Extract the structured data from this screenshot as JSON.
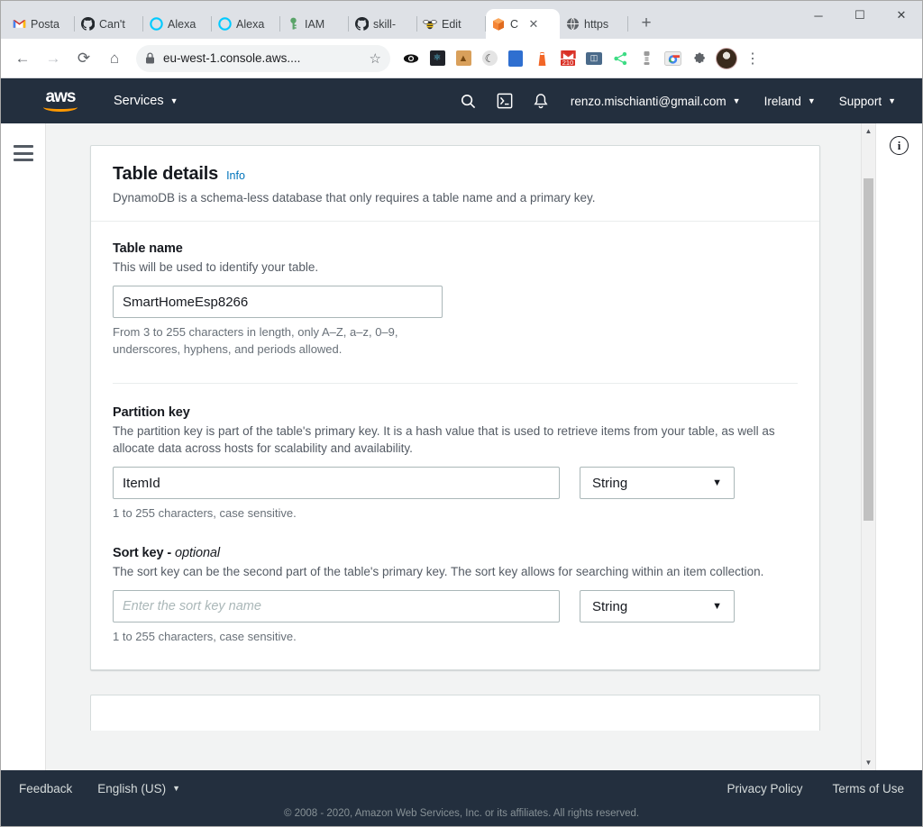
{
  "browser": {
    "tabs": [
      {
        "label": "Posta",
        "icon": "gmail-icon",
        "active": false
      },
      {
        "label": "Can't",
        "icon": "github-icon",
        "active": false
      },
      {
        "label": "Alexa",
        "icon": "alexa-icon",
        "active": false
      },
      {
        "label": "Alexa",
        "icon": "alexa-icon",
        "active": false
      },
      {
        "label": "IAM",
        "icon": "key-icon",
        "active": false
      },
      {
        "label": "skill-",
        "icon": "github-icon",
        "active": false
      },
      {
        "label": "Edit",
        "icon": "bee-icon",
        "active": false
      },
      {
        "label": "C",
        "icon": "aws-cube-icon",
        "active": true
      },
      {
        "label": "https",
        "icon": "globe-icon",
        "active": false
      }
    ],
    "new_tab_label": "+",
    "window_controls": {
      "minimize": "─",
      "maximize": "☐",
      "close": "✕"
    },
    "toolbar": {
      "back": "←",
      "forward": "→",
      "reload": "⟳",
      "home": "⌂",
      "lock_icon": "lock-icon",
      "url": "eu-west-1.console.aws....",
      "bookmark_star": "☆",
      "menu_dots": "⋮"
    },
    "extensions": [
      {
        "name": "eye-icon",
        "glyph": "◉",
        "color": "#1a1a1a",
        "bg": "transparent"
      },
      {
        "name": "react-devtools-icon",
        "glyph": "⚛",
        "color": "#61dafb",
        "bg": "#20232a"
      },
      {
        "name": "camel-notebook-icon",
        "glyph": "🐪",
        "color": "#7a4a12",
        "bg": "#d9a05b"
      },
      {
        "name": "dark-mode-moon-icon",
        "glyph": "☾",
        "color": "#444",
        "bg": "#e8e8e8"
      },
      {
        "name": "blue-square-icon",
        "glyph": "",
        "color": "#fff",
        "bg": "#2f6fd0"
      },
      {
        "name": "lighthouse-icon",
        "glyph": "⛯",
        "color": "#fff",
        "bg": "#f26627"
      },
      {
        "name": "gmail-checker-icon",
        "glyph": "210",
        "color": "#fff",
        "bg": "#d93025"
      },
      {
        "name": "window-icon",
        "glyph": "▣",
        "color": "#fff",
        "bg": "#4a6a8a"
      },
      {
        "name": "share-icon",
        "glyph": "∴",
        "color": "#3ddc84",
        "bg": "transparent"
      },
      {
        "name": "robot-icon",
        "glyph": "♟",
        "color": "#8a8a8a",
        "bg": "transparent"
      },
      {
        "name": "chrome-window-icon",
        "glyph": "◑",
        "color": "#888",
        "bg": "#e9e9e9"
      },
      {
        "name": "puzzle-extension-icon",
        "glyph": "✦",
        "color": "#5f6368",
        "bg": "transparent"
      }
    ]
  },
  "aws": {
    "navbar": {
      "logo_word": "aws",
      "services_label": "Services",
      "search_icon": "search-icon",
      "cloudshell_icon": "cloudshell-icon",
      "bell_icon": "notifications-bell-icon",
      "account": "renzo.mischianti@gmail.com",
      "region": "Ireland",
      "support": "Support",
      "caret": "▼"
    },
    "card": {
      "title": "Table details",
      "info_label": "Info",
      "description": "DynamoDB is a schema-less database that only requires a table name and a primary key.",
      "fields": {
        "table_name": {
          "label": "Table name",
          "description": "This will be used to identify your table.",
          "value": "SmartHomeEsp8266",
          "hint": "From 3 to 255 characters in length, only A–Z, a–z, 0–9, underscores, hyphens, and periods allowed."
        },
        "partition_key": {
          "label": "Partition key",
          "description": "The partition key is part of the table's primary key. It is a hash value that is used to retrieve items from your table, as well as allocate data across hosts for scalability and availability.",
          "value": "ItemId",
          "type": "String",
          "hint": "1 to 255 characters, case sensitive."
        },
        "sort_key": {
          "label": "Sort key - ",
          "label_optional": "optional",
          "description": "The sort key can be the second part of the table's primary key. The sort key allows for searching within an item collection.",
          "placeholder": "Enter the sort key name",
          "type": "String",
          "hint": "1 to 255 characters, case sensitive."
        }
      }
    },
    "right_panel": {
      "info_icon": "info-circle-icon",
      "info_glyph": "i"
    },
    "footer": {
      "feedback": "Feedback",
      "language": "English (US)",
      "caret": "▼",
      "privacy_policy": "Privacy Policy",
      "terms_of_use": "Terms of Use",
      "copyright": "© 2008 - 2020, Amazon Web Services, Inc. or its affiliates. All rights reserved."
    },
    "colors": {
      "navbar_bg": "#232f3e",
      "accent_orange": "#ff9900",
      "link_blue": "#0073bb",
      "page_bg": "#f2f3f3"
    }
  }
}
